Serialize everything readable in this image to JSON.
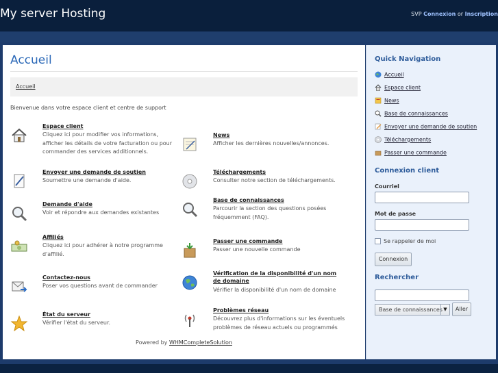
{
  "header": {
    "site_title": "My server Hosting",
    "prompt": "SVP",
    "login_link": "Connexion",
    "or_text": "or",
    "register_link": "Inscription"
  },
  "main": {
    "page_title": "Accueil",
    "breadcrumb": "Accueil",
    "welcome": "Bienvenue dans votre espace client et centre de support",
    "items_left": [
      {
        "icon": "house-icon",
        "title": "Espace client",
        "desc": [
          "Cliquez ici pour modifier vos informations,",
          "afficher les détails de votre facturation ou pour",
          "commander des services additionnels."
        ]
      },
      {
        "icon": "pen-paper-icon",
        "title": "Envoyer une demande de soutien",
        "desc": [
          "Soumettre une demande d'aide."
        ]
      },
      {
        "icon": "magnifier-icon",
        "title": "Demande d'aide",
        "desc": [
          "Voir et répondre aux demandes existantes"
        ]
      },
      {
        "icon": "money-icon",
        "title": "Affiliés",
        "desc": [
          "Cliquez ici pour adhérer à notre programme",
          "d'affilié."
        ]
      },
      {
        "icon": "mail-arrow-icon",
        "title": "Contactez-nous",
        "desc": [
          "Poser vos questions avant de commander"
        ]
      },
      {
        "icon": "star-icon",
        "title": "État du serveur",
        "desc": [
          "Vérifier l'état du serveur."
        ]
      }
    ],
    "items_right": [
      {
        "icon": "notepad-icon",
        "title": "News",
        "desc": [
          "Afficher les dernières nouvelles/annonces."
        ]
      },
      {
        "icon": "disc-icon",
        "title": "Téléchargements",
        "desc": [
          "Consulter notre section de téléchargements."
        ]
      },
      {
        "icon": "magnifier-icon",
        "title": "Base de connaissances",
        "desc": [
          "Parcourir la section des questions posées",
          "fréquemment (FAQ)."
        ]
      },
      {
        "icon": "box-icon",
        "title": "Passer une commande",
        "desc": [
          "Passer une nouvelle commande"
        ]
      },
      {
        "icon": "globe-icon",
        "title": "Vérification de la disponibilité d'un nom de domaine",
        "desc": [
          "Vérifier la disponibilité d'un nom de domaine"
        ]
      },
      {
        "icon": "antenna-icon",
        "title": "Problèmes réseau",
        "desc": [
          "Découvrez plus d'informations sur les éventuels",
          "problèmes de réseau actuels ou programmés"
        ]
      }
    ],
    "powered_by": "Powered by",
    "powered_link": "WHMCompleteSolution"
  },
  "sidebar": {
    "quicknav_title": "Quick Navigation",
    "quicknav": [
      {
        "icon": "globe-icon",
        "label": "Accueil"
      },
      {
        "icon": "house-icon",
        "label": "Espace client"
      },
      {
        "icon": "news-icon",
        "label": "News"
      },
      {
        "icon": "magnifier-icon",
        "label": "Base de connaissances"
      },
      {
        "icon": "pen-paper-icon",
        "label": "Envoyer une demande de soutien"
      },
      {
        "icon": "disc-icon",
        "label": "Téléchargements"
      },
      {
        "icon": "box-icon",
        "label": "Passer une commande"
      }
    ],
    "login_title": "Connexion client",
    "email_label": "Courriel",
    "password_label": "Mot de passe",
    "remember_label": "Se rappeler de moi",
    "login_button": "Connexion",
    "search_title": "Rechercher",
    "search_select": "Base de connaissances",
    "search_button": "Aller"
  },
  "colors": {
    "accent": "#2d6ab8",
    "header_bg": "#0a1f3c",
    "sidebar_bg": "#eaf1fb"
  }
}
